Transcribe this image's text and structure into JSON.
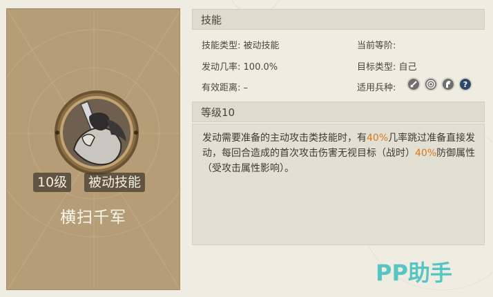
{
  "skill_card": {
    "level_badge": "10级",
    "type_badge": "被动技能",
    "name": "横扫千军",
    "emblem_icon": "swordsman-emblem-icon"
  },
  "skill_section": {
    "title": "技能",
    "skill_type_label": "技能类型:",
    "skill_type_value": "被动技能",
    "trigger_rate_label": "发动几率:",
    "trigger_rate_value": "100.0%",
    "range_label": "有效距离:",
    "range_value": "–",
    "current_stage_label": "当前等阶:",
    "current_stage_value": "",
    "target_type_label": "目标类型:",
    "target_type_value": "自己",
    "unit_types_label": "适用兵种:",
    "unit_type_icons": [
      "sword-icon",
      "target-icon",
      "cavalry-icon",
      "question-icon"
    ]
  },
  "level_section": {
    "title": "等级10",
    "desc_part1": "发动需要准备的主动攻击类技能时，有",
    "desc_hl1": "40%",
    "desc_part2": "几率跳过准备直接发动，每回合造成的首次攻击伤害无视目标（战时）",
    "desc_hl2": "40%",
    "desc_part3": "防御属性（受攻击属性影响）。"
  },
  "watermark": "PP助手",
  "colors": {
    "highlight": "#d9791f",
    "card_bg": "#b49d77",
    "watermark": "#57c5c1"
  }
}
